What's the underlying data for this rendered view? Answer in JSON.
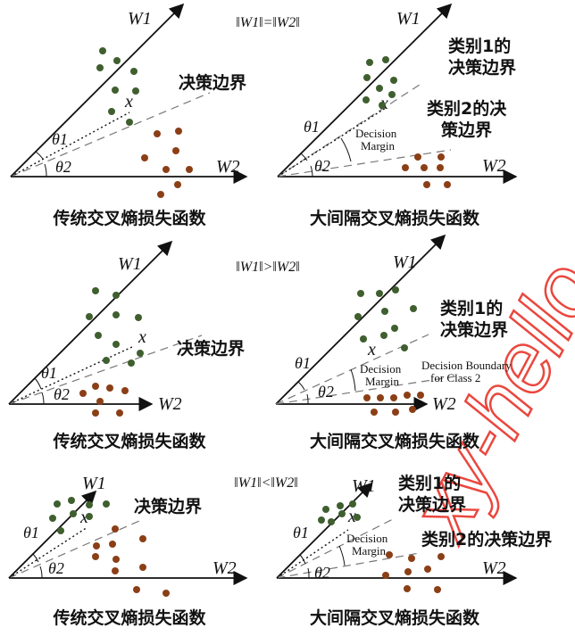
{
  "watermark": "xy-hello",
  "colors": {
    "class1": "#3f5f2f",
    "class2": "#8b3f17",
    "ink": "#111111",
    "dashed": "#777777",
    "watermark": "#e8342a"
  },
  "rows": [
    {
      "condition": "‖W1‖=‖W2‖",
      "left": {
        "w1": "W1",
        "w2": "W2",
        "x": "x",
        "theta1": "θ1",
        "theta2": "θ2",
        "boundary": "决策边界",
        "caption": "传统交叉熵损失函数"
      },
      "right": {
        "w1": "W1",
        "w2": "W2",
        "x": "x",
        "theta1": "θ1",
        "theta2": "θ2",
        "boundary1": "类别1的决策边界",
        "boundary2": "类别2的决策边界",
        "margin": "Decision Margin",
        "caption": "大间隔交叉熵损失函数"
      }
    },
    {
      "condition": "‖W1‖>‖W2‖",
      "left": {
        "w1": "W1",
        "w2": "W2",
        "x": "x",
        "theta1": "θ1",
        "theta2": "θ2",
        "boundary": "决策边界",
        "caption": "传统交叉熵损失函数"
      },
      "right": {
        "w1": "W1",
        "w2": "W2",
        "x": "x",
        "theta1": "θ1",
        "theta2": "θ2",
        "boundary1": "类别1的决策边界",
        "boundary2": "Decision Boundary for Class 2",
        "margin": "Decision Margin",
        "caption": "大间隔交叉熵损失函数"
      }
    },
    {
      "condition": "‖W1‖<‖W2‖",
      "left": {
        "w1": "W1",
        "w2": "W2",
        "x": "x",
        "theta1": "θ1",
        "theta2": "θ2",
        "boundary": "决策边界",
        "caption": "传统交叉熵损失函数"
      },
      "right": {
        "w1": "W1",
        "w2": "W2",
        "x": "x",
        "theta1": "θ1",
        "theta2": "θ2",
        "boundary1": "类别1的决策边界",
        "boundary2": "类别2的决策边界",
        "margin": "Decision Margin",
        "caption": "大间隔交叉熵损失函数"
      }
    }
  ]
}
